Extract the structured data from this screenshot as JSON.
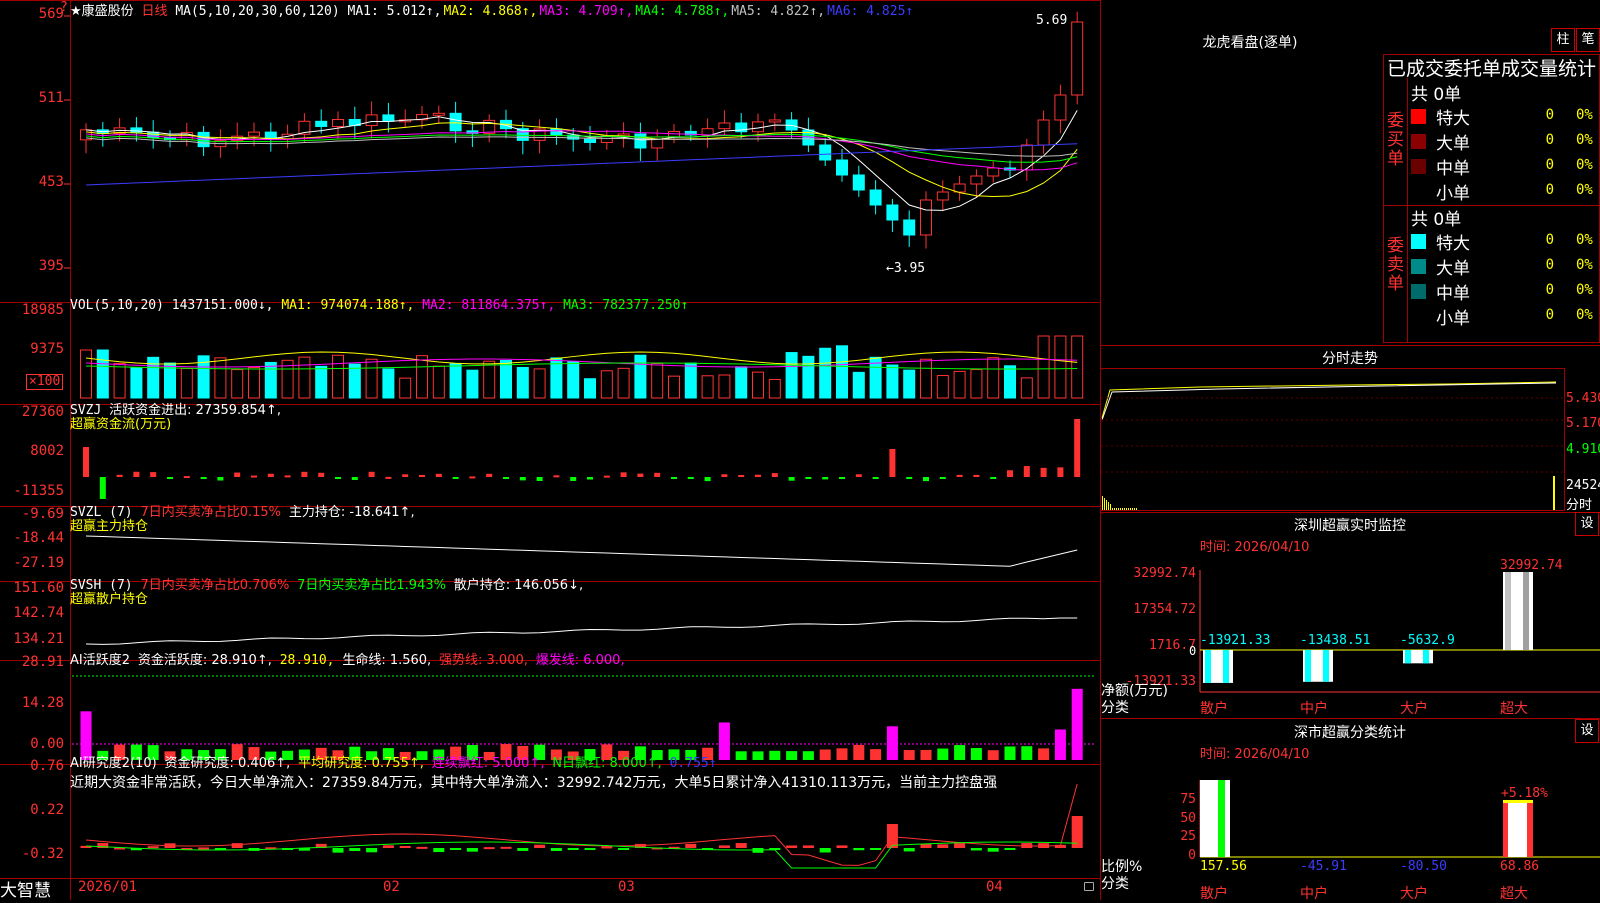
{
  "stock": {
    "name": "★康盛股份",
    "period": "日线",
    "ma_header": {
      "params": "MA(5,10,20,30,60,120)",
      "items": [
        {
          "label": "MA1: 5.012↑,",
          "color": "#ffffff"
        },
        {
          "label": "MA2: 4.868↑,",
          "color": "#ffff00"
        },
        {
          "label": "MA3: 4.709↑,",
          "color": "#ff00ff"
        },
        {
          "label": "MA4: 4.788↑,",
          "color": "#00ff00"
        },
        {
          "label": "MA5: 4.822↑,",
          "color": "#c0c0c0"
        },
        {
          "label": "MA6: 4.825↑",
          "color": "#3c3cff"
        }
      ]
    },
    "high_label": "5.69",
    "low_label": "←3.95",
    "axis": [
      "569",
      "511",
      "453",
      "395"
    ],
    "corner_icon": "question-icon"
  },
  "volume": {
    "header_label": "VOL(5,10,20)",
    "value": "1437151.000↓,",
    "ma1": "MA1: 974074.188↑,",
    "ma2": "MA2: 811864.375↑,",
    "ma3": "MA3: 782377.250↑",
    "axis": [
      "18985",
      "9375"
    ],
    "unit": "×100"
  },
  "svzj": {
    "header_label": "SVZJ",
    "header_text": "活跃资金进出: 27359.854↑,",
    "subtitle": "超赢资金流(万元)",
    "axis": [
      "27360",
      "8002",
      "-11355"
    ]
  },
  "svzl": {
    "header_label": "SVZL (7)",
    "pct": "7日内买卖净占比0.15%",
    "pos": "主力持仓: -18.641↑,",
    "subtitle": "超赢主力持仓",
    "axis": [
      "-9.69",
      "-18.44",
      "-27.19"
    ]
  },
  "svsh": {
    "header_label": "SVSH (7)",
    "pct1": "7日内买卖净占比0.706%",
    "pct2": "7日内买卖净占比1.943%",
    "pos": "散户持仓: 146.056↓,",
    "subtitle": "超赢散户持仓",
    "axis": [
      "151.60",
      "142.74",
      "134.21"
    ]
  },
  "ai_act": {
    "header_label": "AI活跃度2",
    "text1": "资金活跃度: 28.910↑,",
    "text2": "28.910,",
    "text3": "生命线: 1.560,",
    "text4": "强势线: 3.000,",
    "text5": "爆发线: 6.000,",
    "axis": [
      "28.91",
      "14.28",
      "0.00"
    ]
  },
  "ai_res": {
    "header_label": "AI研究度2(10)",
    "text1": "资金研究度: 0.406↑,",
    "text2": "平均研究度: 0.755↑,",
    "text3": "连续飘红: 5.000↑,",
    "text4": "N日飘红: 8.000↑,",
    "text5": "0.755↑",
    "comment": "近期大资金非常活跃，今日大单净流入：27359.84万元，其中特大单净流入：32992.742万元，大单5日累计净入41310.113万元，当前主力控盘强",
    "axis": [
      "0.76",
      "0.22",
      "-0.32"
    ]
  },
  "xaxis": {
    "labels": [
      "2026/01",
      "02",
      "03",
      "04"
    ],
    "brand": "大智慧",
    "lock_icon": "lock-icon"
  },
  "dragon": {
    "title": "龙虎看盘(逐单)",
    "btn1": "柱",
    "btn2": "笔",
    "subtitle": "已成交委托单成交量统计",
    "buy": {
      "side_label": "委买单",
      "total": "共 0单",
      "rows": [
        {
          "label": "特大",
          "value": "0",
          "pct": "0%",
          "color": "#ff0000"
        },
        {
          "label": "大单",
          "value": "0",
          "pct": "0%",
          "color": "#8b0000"
        },
        {
          "label": "中单",
          "value": "0",
          "pct": "0%",
          "color": "#6b0000"
        },
        {
          "label": "小单",
          "value": "0",
          "pct": "0%",
          "color": ""
        }
      ]
    },
    "sell": {
      "side_label": "委卖单",
      "total": "共 0单",
      "rows": [
        {
          "label": "特大",
          "value": "0",
          "pct": "0%",
          "color": "#00ffff"
        },
        {
          "label": "大单",
          "value": "0",
          "pct": "0%",
          "color": "#008b8b"
        },
        {
          "label": "中单",
          "value": "0",
          "pct": "0%",
          "color": "#006b6b"
        },
        {
          "label": "小单",
          "value": "0",
          "pct": "0%",
          "color": ""
        }
      ]
    }
  },
  "intraday": {
    "title": "分时走势",
    "axis": [
      "5.430",
      "5.170",
      "4.910"
    ],
    "vol_label": "24524",
    "unit_label": "分时"
  },
  "realtime": {
    "title": "深圳超赢实时监控",
    "settings_btn": "设",
    "time": "时间: 2026/04/10",
    "axis": [
      "32992.74",
      "17354.72",
      "1716.7",
      "-13921.33"
    ],
    "zero": "0",
    "ylabel1": "净额(万元)",
    "ylabel2": "分类",
    "categories": [
      "散户",
      "中户",
      "大户",
      "超大"
    ],
    "values": [
      -13921.33,
      -13438.51,
      -5632.9,
      32992.74
    ],
    "value_labels": [
      "-13921.33",
      "-13438.51",
      "-5632.9",
      "32992.74"
    ]
  },
  "classify": {
    "title": "深市超赢分类统计",
    "settings_btn": "设",
    "time": "时间: 2026/04/10",
    "axis": [
      "75",
      "50",
      "25",
      "0"
    ],
    "ylabel1": "比例%",
    "ylabel2": "分类",
    "categories": [
      "散户",
      "中户",
      "大户",
      "超大"
    ],
    "values": [
      157.56,
      -45.91,
      -80.5,
      68.86
    ],
    "value_labels": [
      "157.56",
      "-45.91",
      "-80.50",
      "68.86"
    ],
    "top_label": "+5.18%"
  },
  "chart_data": {
    "type": "bar",
    "title": "深圳超赢实时监控",
    "categories": [
      "散户",
      "中户",
      "大户",
      "超大"
    ],
    "series": [
      {
        "name": "净额(万元)",
        "values": [
          -13921.33,
          -13438.51,
          -5632.9,
          32992.74
        ]
      }
    ],
    "ylim": [
      -13921.33,
      32992.74
    ]
  }
}
